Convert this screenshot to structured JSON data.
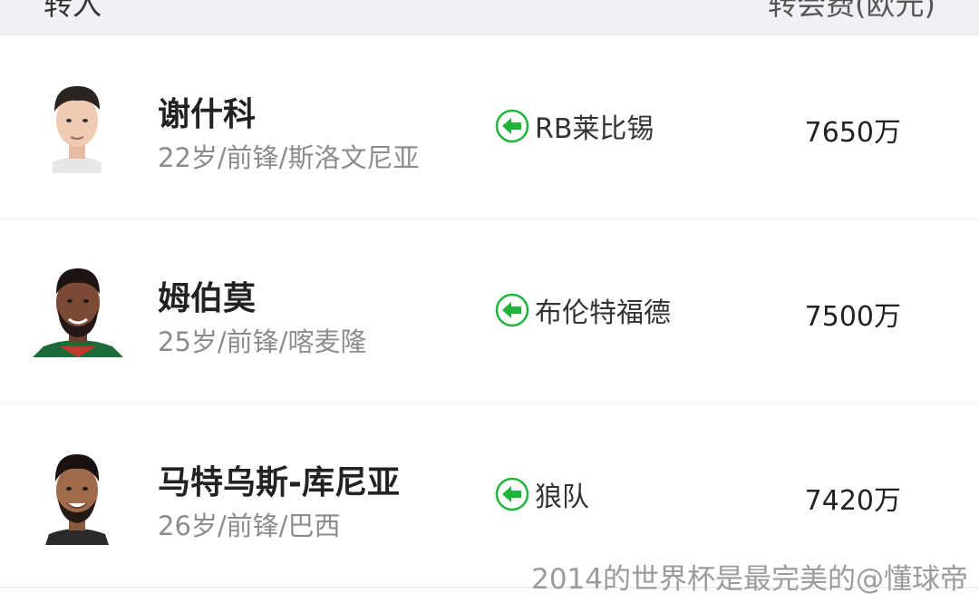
{
  "header": {
    "left_label": "转入",
    "right_label": "转会费(欧元)"
  },
  "transfers": [
    {
      "name": "谢什科",
      "info": "22岁/前锋/斯洛文尼亚",
      "club": "RB莱比锡",
      "fee": "7650万",
      "club_icon": "arrow-left-icon"
    },
    {
      "name": "姆伯莫",
      "info": "25岁/前锋/喀麦隆",
      "club": "布伦特福德",
      "fee": "7500万",
      "club_icon": "arrow-left-icon"
    },
    {
      "name": "马特乌斯-库尼亚",
      "info": "26岁/前锋/巴西",
      "club": "狼队",
      "fee": "7420万",
      "club_icon": "arrow-left-icon"
    }
  ],
  "watermark": "2014的世界杯是最完美的@懂球帝",
  "colors": {
    "accent_green": "#1fb53a",
    "header_bg": "#eff1f4"
  }
}
